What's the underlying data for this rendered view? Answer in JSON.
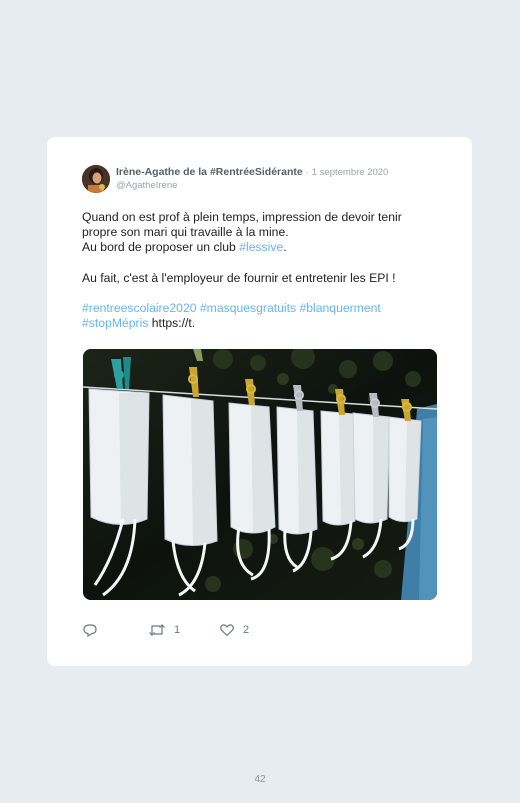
{
  "tweet": {
    "author_name": "Irène-Agathe de la #RentréeSidérante",
    "separator": "·",
    "date": "1 septembre 2020",
    "handle": "@AgatheIrene",
    "lines": [
      "Quand on est prof à plein temps, impression de devoir tenir",
      "propre son mari qui travaille à la mine.",
      "Au bord de proposer un club "
    ],
    "hashtag_inline": "#lessive",
    "line3_suffix": ".",
    "line4": "Au fait, c'est à l'employeur de fournir et entretenir les EPI !",
    "hashtags_line1": "#rentreescolaire2020 #masquesgratuits #blanquerment",
    "hashtags_line2": "#stopMépris",
    "link_text": " https://t.",
    "retweet_count": "1",
    "like_count": "2",
    "reply_icon": "reply-icon",
    "retweet_icon": "retweet-icon",
    "like_icon": "heart-icon",
    "accent_color": "#66b6e8"
  },
  "page": {
    "number": "42"
  }
}
